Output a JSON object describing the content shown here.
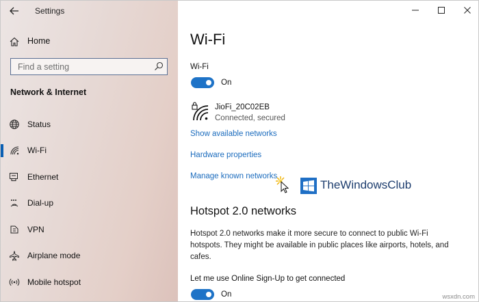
{
  "window": {
    "title": "Settings"
  },
  "sidebar": {
    "home_label": "Home",
    "search_placeholder": "Find a setting",
    "section_title": "Network & Internet",
    "items": [
      {
        "label": "Status",
        "icon": "globe-icon"
      },
      {
        "label": "Wi-Fi",
        "icon": "wifi-icon",
        "selected": true
      },
      {
        "label": "Ethernet",
        "icon": "ethernet-icon"
      },
      {
        "label": "Dial-up",
        "icon": "dialup-icon"
      },
      {
        "label": "VPN",
        "icon": "vpn-icon"
      },
      {
        "label": "Airplane mode",
        "icon": "airplane-icon"
      },
      {
        "label": "Mobile hotspot",
        "icon": "hotspot-icon"
      }
    ]
  },
  "main": {
    "title": "Wi-Fi",
    "wifi_label": "Wi-Fi",
    "wifi_toggle_state": "On",
    "network": {
      "name": "JioFi_20C02EB",
      "status": "Connected, secured"
    },
    "links": {
      "show_available": "Show available networks",
      "hardware_properties": "Hardware properties",
      "manage_known": "Manage known networks"
    },
    "hotspot": {
      "heading": "Hotspot 2.0 networks",
      "description": "Hotspot 2.0 networks make it more secure to connect to public Wi-Fi hotspots. They might be available in public places like airports, hotels, and cafes.",
      "signup_label": "Let me use Online Sign-Up to get connected",
      "signup_toggle_state": "On"
    }
  },
  "watermark": {
    "text": "TheWindowsClub"
  },
  "site_watermark": "wsxdn.com",
  "colors": {
    "accent": "#1e73c7",
    "link": "#1a6bbd",
    "selection": "#0a5fb3"
  }
}
